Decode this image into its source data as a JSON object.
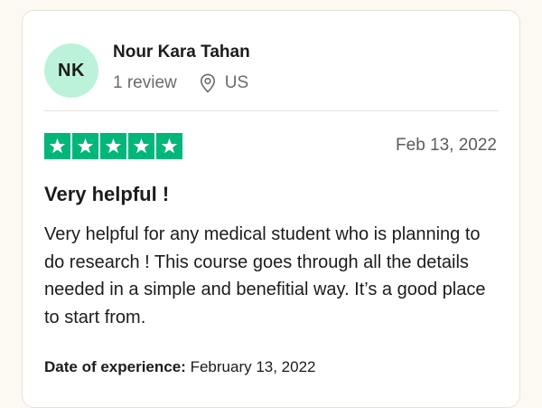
{
  "review": {
    "user": {
      "initials": "NK",
      "name": "Nour Kara Tahan",
      "review_count": "1 review",
      "location": "US",
      "avatar_color": "#bdf2da"
    },
    "rating": {
      "stars": 5,
      "max_stars": 5,
      "star_color": "#00b67a",
      "icon": "star-icon"
    },
    "date": "Feb 13, 2022",
    "title": "Very helpful !",
    "body": "Very helpful for any medical student who is planning to do research ! This course goes through all the details needed in a simple and benefitial way. It’s a good place to start from.",
    "experience_label": "Date of experience:",
    "experience_date": "February 13, 2022"
  }
}
